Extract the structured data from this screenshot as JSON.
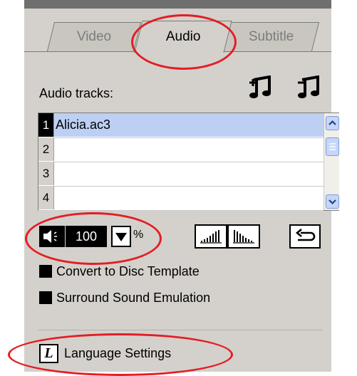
{
  "tabs": [
    {
      "label": "Video",
      "active": false
    },
    {
      "label": "Audio",
      "active": true
    },
    {
      "label": "Subtitle",
      "active": false
    }
  ],
  "audio": {
    "tracks_label": "Audio tracks:",
    "add_track_icon": "add-music-note-icon",
    "remove_track_icon": "remove-music-note-icon",
    "tracks": [
      {
        "number": "1",
        "name": "Alicia.ac3",
        "selected": true
      },
      {
        "number": "2",
        "name": "",
        "selected": false
      },
      {
        "number": "3",
        "name": "",
        "selected": false
      },
      {
        "number": "4",
        "name": "",
        "selected": false
      }
    ]
  },
  "volume": {
    "value": "100",
    "unit": "%"
  },
  "options": {
    "convert_label": "Convert to Disc Template",
    "surround_label": "Surround Sound Emulation"
  },
  "language": {
    "icon_letter": "L",
    "label": "Language Settings"
  },
  "colors": {
    "panel_bg": "#d4d1cc",
    "highlight_ellipse": "#e31e24",
    "selected_row": "#bdcff2"
  }
}
